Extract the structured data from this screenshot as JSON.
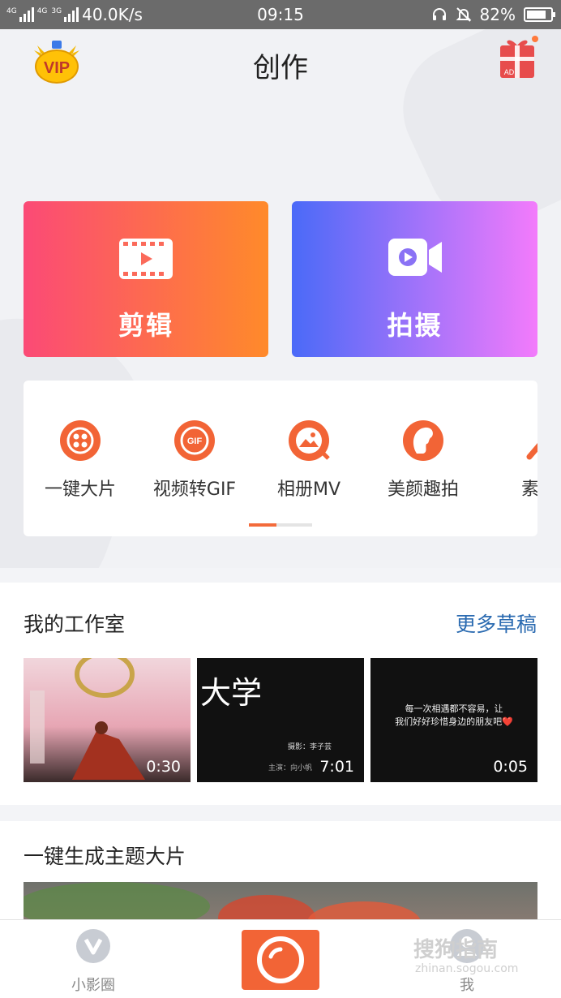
{
  "status_bar": {
    "net_label_1": "4G",
    "net_label_2": "4G",
    "net_label_3": "3G",
    "speed": "40.0K/s",
    "time": "09:15",
    "battery": "82%",
    "battery_level": 0.82
  },
  "header": {
    "title": "创作",
    "vip_label": "VIP",
    "ad_label": "AD"
  },
  "cards": {
    "edit_label": "剪辑",
    "shoot_label": "拍摄"
  },
  "tools": [
    {
      "label": "一键大片",
      "icon": "dots-icon"
    },
    {
      "label": "视频转GIF",
      "icon": "gif-icon"
    },
    {
      "label": "相册MV",
      "icon": "album-mv-icon"
    },
    {
      "label": "美颜趣拍",
      "icon": "beauty-icon"
    },
    {
      "label": "素材",
      "icon": "magic-wand-icon"
    }
  ],
  "studio": {
    "title": "我的工作室",
    "more": "更多草稿",
    "drafts": [
      {
        "duration": "0:30",
        "caption": ""
      },
      {
        "duration": "7:01",
        "caption": "大学",
        "line1": "摄影：李子芸",
        "line2": "主演：向小帆"
      },
      {
        "duration": "0:05",
        "caption": "",
        "line1": "每一次相遇都不容易，让",
        "line2": "我们好好珍惜身边的朋友吧❤️"
      }
    ]
  },
  "theme": {
    "title": "一键生成主题大片"
  },
  "tabbar": {
    "left_label": "小影圈",
    "right_label": "我"
  },
  "watermark": {
    "text": "搜狗指南",
    "sub": "zhinan.sogou.com"
  },
  "colors": {
    "accent": "#f26436",
    "link": "#2b6bb1",
    "edit_grad_start": "#fb4a76",
    "edit_grad_end": "#ff8a2a",
    "shoot_grad_start": "#4a6af8",
    "shoot_grad_end": "#f37bfb"
  }
}
